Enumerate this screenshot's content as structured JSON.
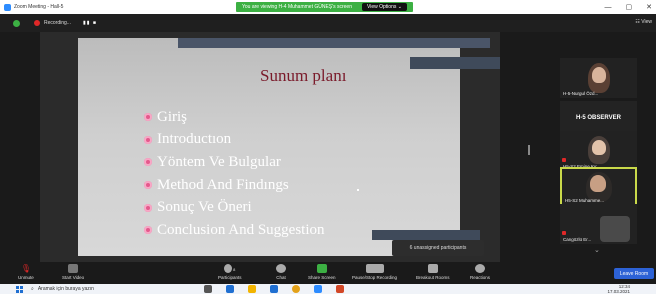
{
  "window": {
    "title": "Zoom Meeting - Hall-5",
    "share_banner": "You are viewing H-4 Muhammet GÜNEŞ's screen",
    "view_options": "View Options ⌄",
    "controls": [
      "—",
      "▢",
      "✕"
    ]
  },
  "topbar": {
    "recording": "Recording...",
    "rec_controls": "▮▮ ■",
    "gallery": "☷ View"
  },
  "slide": {
    "title": "Sunum planı",
    "bullets": [
      "Giriş",
      "Introductıon",
      "Yöntem Ve Bulgular",
      "Method And Findıngs",
      "Sonuç Ve Öneri",
      "Conclusion And Suggestion"
    ]
  },
  "unassigned": "6 unassigned participants",
  "participants": [
    {
      "name": "H-5-Nurgul Özd..."
    },
    {
      "name": "H-5 OBSERVER"
    },
    {
      "name": "H5-S2 Emine Kır..."
    },
    {
      "name": "H5-S2 Muhamme..."
    },
    {
      "name": "Cangözlü Er..."
    }
  ],
  "toolbar": {
    "unmute": "Unmute",
    "start_video": "Start Video",
    "participants": "Participants",
    "participants_count": "8",
    "chat": "Chat",
    "share_screen": "Share Screen",
    "pause_recording": "Pause/Stop Recording",
    "breakout": "Breakout Rooms",
    "reactions": "Reactions",
    "leave": "Leave Room"
  },
  "taskbar": {
    "search": "Aramak için buraya yazın",
    "time": "12:34",
    "date": "17.03.2021"
  },
  "colors": {
    "share_green": "#3cb043",
    "leave_blue": "#2d62d6",
    "slide_title": "#7a1a2a",
    "bullet_pink": "#e4598c"
  }
}
